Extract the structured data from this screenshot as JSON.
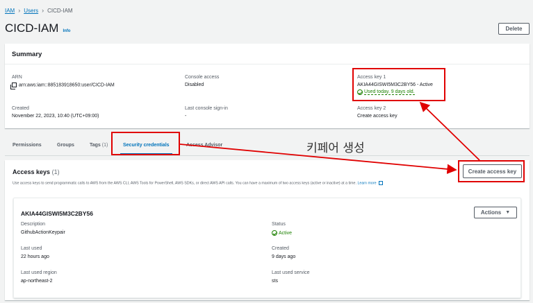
{
  "breadcrumb": {
    "iam": "IAM",
    "users": "Users",
    "current": "CICD-IAM"
  },
  "page": {
    "title": "CICD-IAM",
    "info": "Info",
    "delete_label": "Delete"
  },
  "summary": {
    "heading": "Summary",
    "arn_label": "ARN",
    "arn_value": "arn:aws:iam::885183918650:user/CICD-IAM",
    "console_access_label": "Console access",
    "console_access_value": "Disabled",
    "access_key1_label": "Access key 1",
    "access_key1_value": "AKIA44GISWI5M3C2BY56 - Active",
    "access_key1_status": "Used today. 9 days old.",
    "created_label": "Created",
    "created_value": "November 22, 2023, 10:40 (UTC+09:00)",
    "last_signin_label": "Last console sign-in",
    "last_signin_value": "-",
    "access_key2_label": "Access key 2",
    "access_key2_link": "Create access key"
  },
  "tabs": [
    {
      "label": "Permissions"
    },
    {
      "label": "Groups"
    },
    {
      "label": "Tags",
      "count": "(1)"
    },
    {
      "label": "Security credentials"
    },
    {
      "label": "Access Advisor"
    }
  ],
  "annotation": {
    "text": "키페어 생성",
    "color": "#e00000"
  },
  "access_keys": {
    "heading": "Access keys",
    "count": "(1)",
    "description": "Use access keys to send programmatic calls to AWS from the AWS CLI, AWS Tools for PowerShell, AWS SDKs, or direct AWS API calls. You can have a maximum of two access keys (active or inactive) at a time.",
    "learn_more": "Learn more",
    "create_label": "Create access key"
  },
  "key_card": {
    "key_id": "AKIA44GISWI5M3C2BY56",
    "actions_label": "Actions",
    "description_label": "Description",
    "description_value": "GithubActionKeypair",
    "status_label": "Status",
    "status_value": "Active",
    "last_used_label": "Last used",
    "last_used_value": "22 hours ago",
    "created_label": "Created",
    "created_value": "9 days ago",
    "last_region_label": "Last used region",
    "last_region_value": "ap-northeast-2",
    "last_service_label": "Last used service",
    "last_service_value": "sts"
  },
  "colors": {
    "link": "#0073bb",
    "success": "#1d8102",
    "annotation": "#e00000"
  }
}
